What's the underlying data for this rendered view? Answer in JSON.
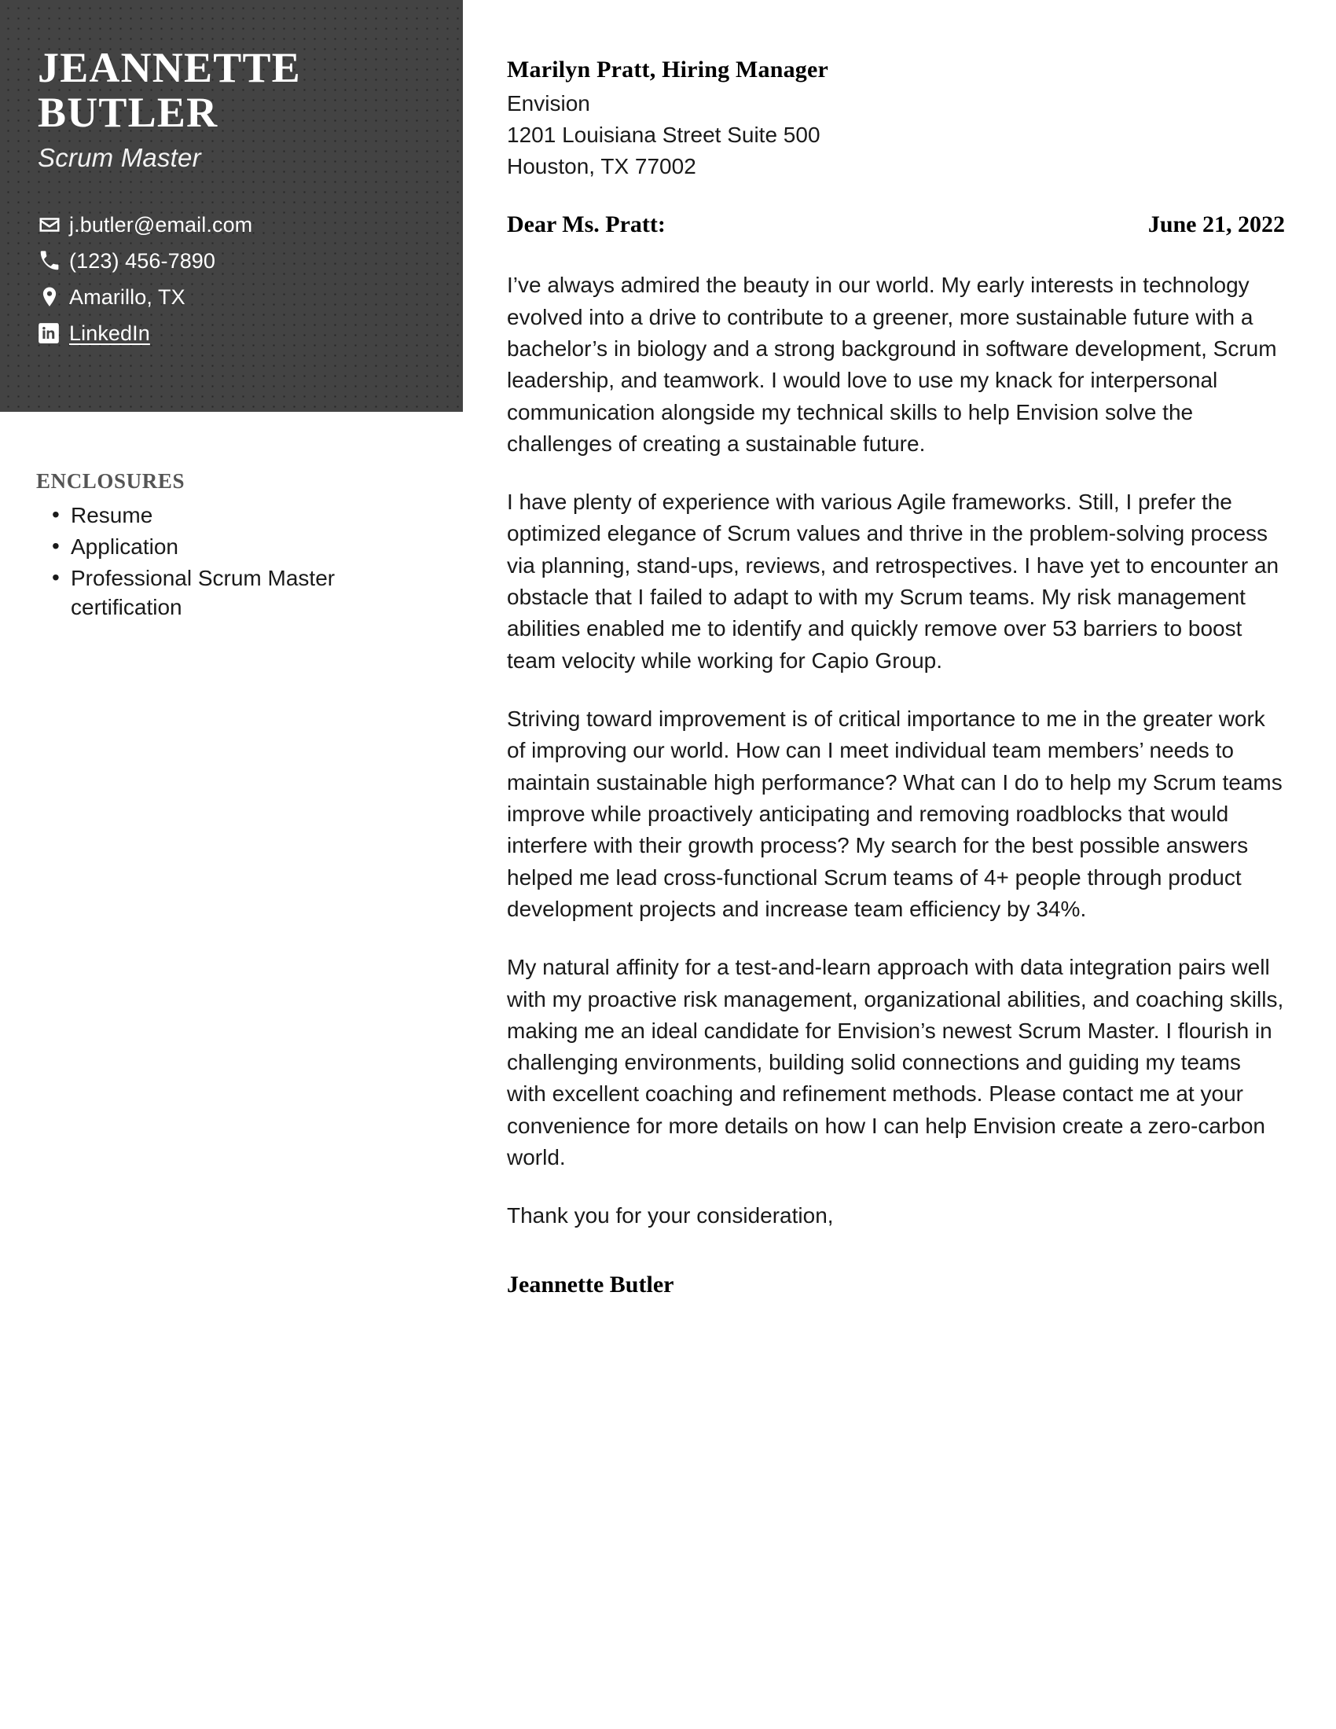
{
  "sidebar": {
    "name_line1": "JEANNETTE",
    "name_line2": "BUTLER",
    "job_title": "Scrum Master",
    "contacts": [
      {
        "icon": "envelope-icon",
        "text": "j.butler@email.com"
      },
      {
        "icon": "phone-icon",
        "text": "(123) 456-7890"
      },
      {
        "icon": "map-pin-icon",
        "text": "Amarillo, TX"
      },
      {
        "icon": "linkedin-icon",
        "text": "LinkedIn"
      }
    ],
    "panel_color": "#434343",
    "text_color": "#ffffff"
  },
  "enclosures": {
    "heading": "ENCLOSURES",
    "items": [
      "Resume",
      "Application",
      "Professional Scrum Master certification"
    ]
  },
  "letter": {
    "recipient_name": "Marilyn Pratt, Hiring Manager",
    "recipient_company": "Envision",
    "recipient_street": "1201 Louisiana Street Suite 500",
    "recipient_city": "Houston, TX 77002",
    "salutation": "Dear Ms. Pratt:",
    "date": "June 21, 2022",
    "paragraphs": [
      "I’ve always admired the beauty in our world. My early interests in technology evolved into a drive to contribute to a greener, more sustainable future with a bachelor’s in biology and a strong background in software development, Scrum leadership, and teamwork. I would love to use my knack for interpersonal communication alongside my technical skills to help Envision solve the challenges of creating a sustainable future.",
      "I have plenty of experience with various Agile frameworks. Still, I prefer the optimized elegance of Scrum values and thrive in the problem-solving process via planning, stand-ups, reviews, and retrospectives. I have yet to encounter an obstacle that I failed to adapt to with my Scrum teams. My risk management abilities enabled me to identify and quickly remove over 53 barriers to boost team velocity while working for Capio Group.",
      "Striving toward improvement is of critical importance to me in the greater work of improving our world. How can I meet individual team members’ needs to maintain sustainable high performance? What can I do to help my Scrum teams improve while proactively anticipating and removing roadblocks that would interfere with their growth process? My search for the best possible answers helped me lead cross-functional Scrum teams of 4+ people through product development projects and increase team efficiency by 34%.",
      "My natural affinity for a test-and-learn approach with data integration pairs well with my proactive risk management, organizational abilities, and coaching skills, making me an ideal candidate for Envision’s newest Scrum Master. I flourish in challenging environments, building solid connections and guiding my teams with excellent coaching and refinement methods. Please contact me at your convenience for more details on how I can help Envision create a zero-carbon world."
    ],
    "closing": "Thank you for your consideration,",
    "signature": "Jeannette Butler"
  }
}
